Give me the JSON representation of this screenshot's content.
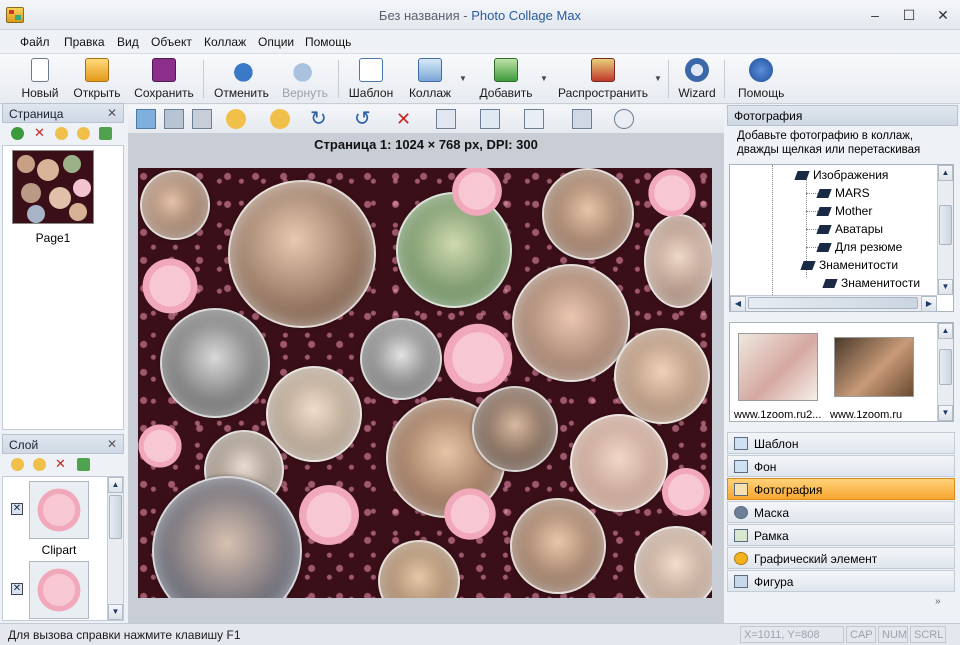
{
  "window": {
    "title_prefix": "Без названия - ",
    "app_name": "Photo Collage Max",
    "minimize": "–",
    "maximize": "☐",
    "close": "✕"
  },
  "menu": [
    "Файл",
    "Правка",
    "Вид",
    "Объект",
    "Коллаж",
    "Опции",
    "Помощь"
  ],
  "toolbar": {
    "new": "Новый",
    "open": "Открыть",
    "save": "Сохранить",
    "undo": "Отменить",
    "redo": "Вернуть",
    "template": "Шаблон",
    "collage": "Коллаж",
    "add": "Добавить",
    "spread": "Распространить",
    "wizard": "Wizard",
    "help": "Помощь"
  },
  "pages_panel": {
    "title": "Страница",
    "close": "✕",
    "items": [
      {
        "label": "Page1"
      }
    ]
  },
  "layers_panel": {
    "title": "Слой",
    "close": "✕",
    "items": [
      {
        "label": "Clipart"
      },
      {
        "label": ""
      }
    ]
  },
  "canvas": {
    "page_info": "Страница 1: 1024 × 768 px, DPI: 300"
  },
  "photo_panel": {
    "title": "Фотография",
    "hint": "Добавьте фотографию в коллаж, дважды щелкая или перетаскивая",
    "tree": [
      "Изображения",
      "MARS",
      "Mother",
      "Аватары",
      "Для резюме",
      "Знаменитости",
      "Знаменитости"
    ],
    "thumbs": [
      "www.1zoom.ru2...",
      "www.1zoom.ru"
    ]
  },
  "accordion": [
    "Шаблон",
    "Фон",
    "Фотография",
    "Маска",
    "Рамка",
    "Графический элемент",
    "Фигура"
  ],
  "statusbar": {
    "text": "Для вызова справки нажмите клавишу F1",
    "coords": "X=1011, Y=808",
    "cap": "CAP",
    "num": "NUM",
    "scrl": "SCRL"
  }
}
